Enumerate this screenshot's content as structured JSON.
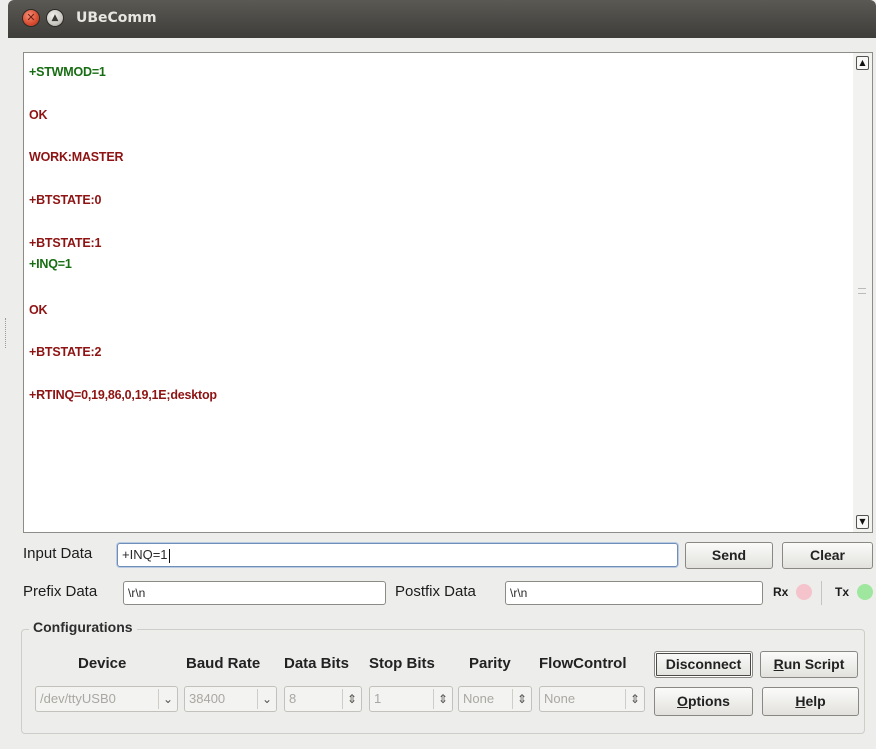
{
  "window": {
    "title": "UBeComm"
  },
  "output": {
    "lines": [
      {
        "text": "+STWMOD=1",
        "kind": "tx"
      },
      {
        "text": "OK",
        "kind": "rx"
      },
      {
        "text": "WORK:MASTER",
        "kind": "rx"
      },
      {
        "text": "+BTSTATE:0",
        "kind": "rx"
      },
      {
        "text": "+BTSTATE:1",
        "kind": "rx"
      },
      {
        "text": "+INQ=1",
        "kind": "tx"
      },
      {
        "text": "OK",
        "kind": "rx"
      },
      {
        "text": "+BTSTATE:2",
        "kind": "rx"
      },
      {
        "text": "+RTINQ=0,19,86,0,19,1E;desktop",
        "kind": "rx"
      }
    ],
    "colors": {
      "tx": "#176d12",
      "rx": "#8e1313"
    }
  },
  "input": {
    "label": "Input Data",
    "value": "+INQ=1"
  },
  "buttons": {
    "send": "Send",
    "clear": "Clear",
    "disconnect": "Disconnect",
    "run_script_mnemonic": "R",
    "run_script_rest": "un Script",
    "options_mnemonic": "O",
    "options_rest": "ptions",
    "help_mnemonic": "H",
    "help_rest": "elp"
  },
  "prefix": {
    "label": "Prefix Data",
    "value": "\\r\\n"
  },
  "postfix": {
    "label": "Postfix Data",
    "value": "\\r\\n"
  },
  "indicators": {
    "rx_label": "Rx",
    "tx_label": "Tx",
    "rx_color": "#f5c3cb",
    "tx_color": "#9fe79e"
  },
  "config": {
    "title": "Configurations",
    "headers": {
      "device": "Device",
      "baud": "Baud Rate",
      "data_bits": "Data Bits",
      "stop_bits": "Stop Bits",
      "parity": "Parity",
      "flow": "FlowControl"
    },
    "values": {
      "device": "/dev/ttyUSB0",
      "baud": "38400",
      "data_bits": "8",
      "stop_bits": "1",
      "parity": "None",
      "flow": "None"
    }
  },
  "icons": {
    "close": "close-icon",
    "maximize": "maximize-icon"
  }
}
